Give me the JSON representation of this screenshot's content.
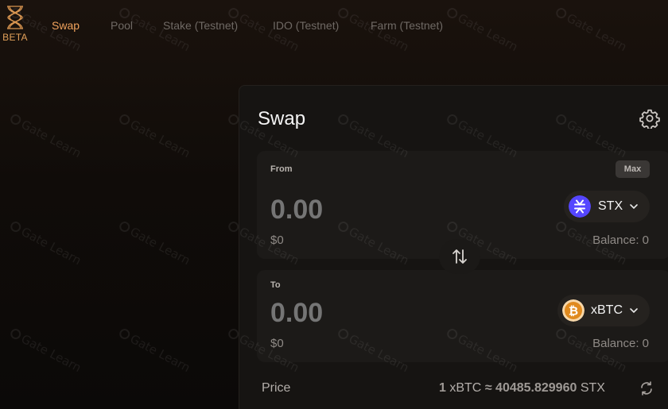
{
  "brand": {
    "badge": "BETA",
    "accent": "#f0a25c"
  },
  "nav": {
    "items": [
      {
        "label": "Swap",
        "active": true
      },
      {
        "label": "Pool",
        "active": false
      },
      {
        "label": "Stake (Testnet)",
        "active": false
      },
      {
        "label": "IDO (Testnet)",
        "active": false
      },
      {
        "label": "Farm (Testnet)",
        "active": false
      }
    ]
  },
  "watermark": {
    "text": "Gate Learn"
  },
  "swap": {
    "title": "Swap",
    "settings_icon": "gear-icon",
    "from": {
      "label": "From",
      "max_label": "Max",
      "amount": "0.00",
      "usd": "$0",
      "token": "STX",
      "token_color": "#5546ff",
      "balance": "Balance: 0"
    },
    "switch_icon": "swap-vertical-arrows-icon",
    "to": {
      "label": "To",
      "amount": "0.00",
      "usd": "$0",
      "token": "xBTC",
      "token_color": "#f7931a",
      "balance": "Balance: 0"
    },
    "price": {
      "label": "Price",
      "lhs_amount": "1",
      "lhs_token": "xBTC",
      "approx": "≈",
      "rhs_amount": "40485.829960",
      "rhs_token": "STX",
      "refresh_icon": "refresh-icon"
    }
  }
}
